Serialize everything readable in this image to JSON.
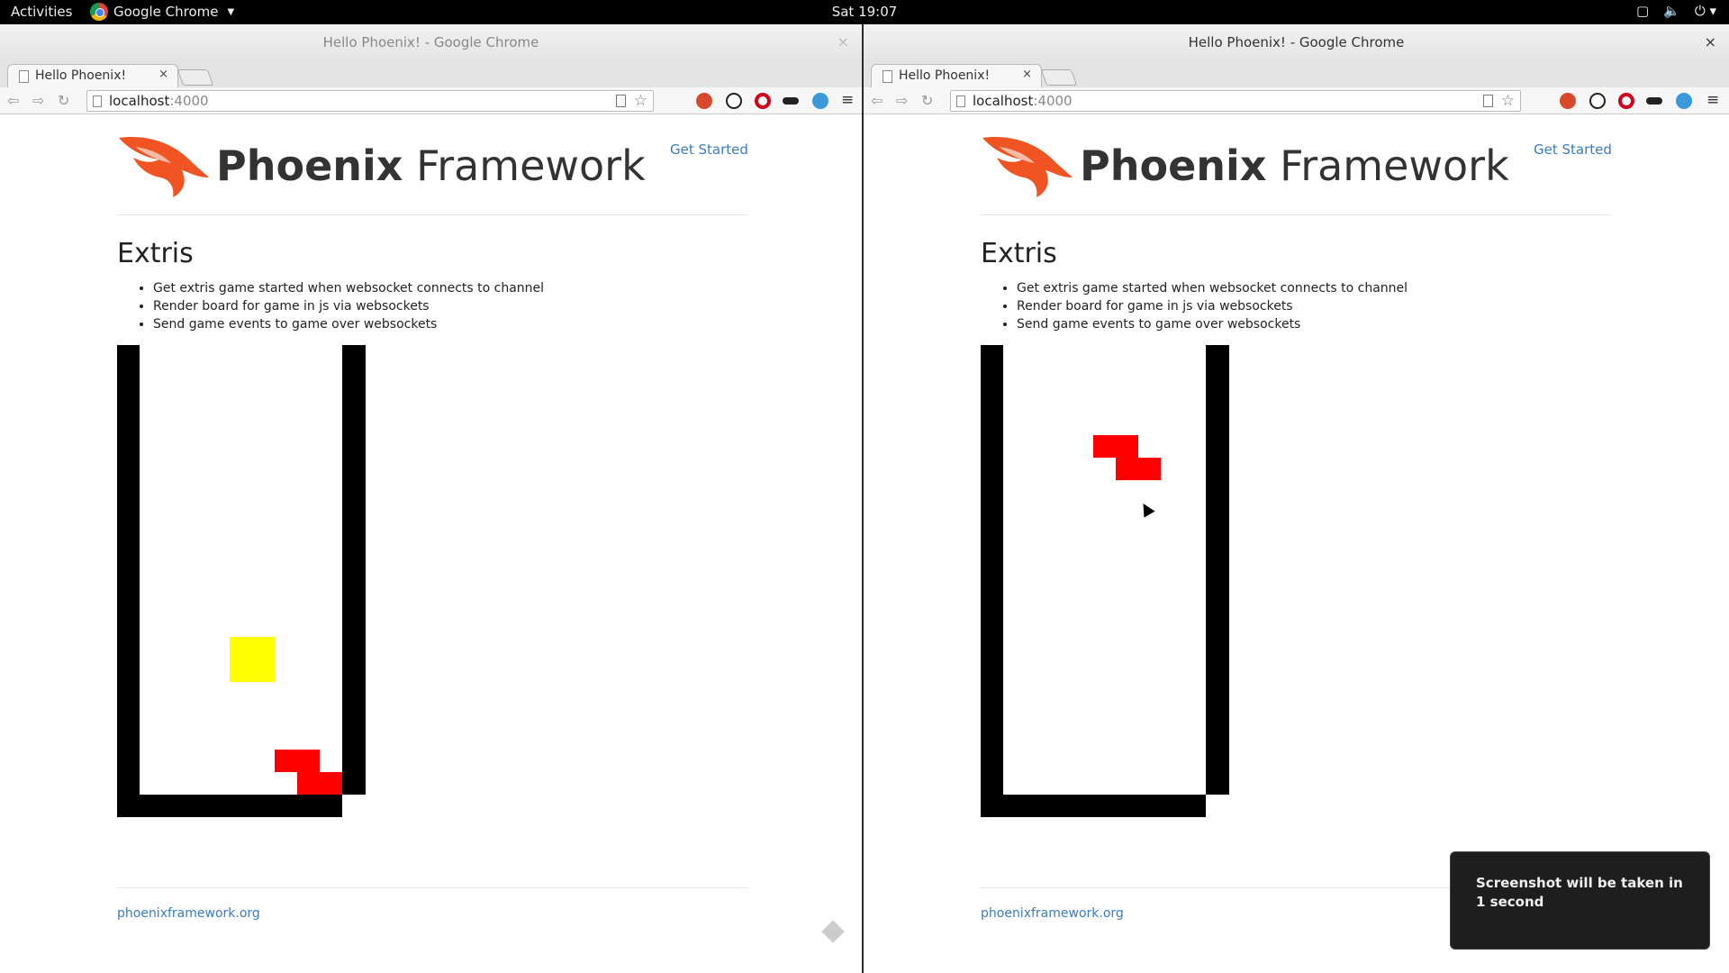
{
  "topbar": {
    "activities": "Activities",
    "app_name": "Google Chrome",
    "clock": "Sat 19:07"
  },
  "windows": [
    {
      "title": "Hello Phoenix! - Google Chrome",
      "tab_label": "Hello Phoenix!",
      "url_host": "localhost",
      "url_port": ":4000",
      "logo_bold": "Phoenix",
      "logo_light": " Framework",
      "nav_link": "Get Started",
      "heading": "Extris",
      "bullets": [
        "Get extris game started when websocket connects to channel",
        "Render board for game in js via websockets",
        "Send game events to game over websockets"
      ],
      "footer_link": "phoenixframework.org",
      "board_pieces": [
        {
          "shape": "O",
          "color": "#ffff00"
        },
        {
          "shape": "Z",
          "color": "#ff0000"
        }
      ]
    },
    {
      "title": "Hello Phoenix! - Google Chrome",
      "tab_label": "Hello Phoenix!",
      "url_host": "localhost",
      "url_port": ":4000",
      "logo_bold": "Phoenix",
      "logo_light": " Framework",
      "nav_link": "Get Started",
      "heading": "Extris",
      "bullets": [
        "Get extris game started when websocket connects to channel",
        "Render board for game in js via websockets",
        "Send game events to game over websockets"
      ],
      "footer_link": "phoenixframework.org",
      "board_pieces": [
        {
          "shape": "Z",
          "color": "#ff0000"
        }
      ]
    }
  ],
  "toast": {
    "message": "Screenshot will be taken in 1 second"
  },
  "colors": {
    "link": "#3a7dbf",
    "phoenix_orange": "#f05423"
  }
}
